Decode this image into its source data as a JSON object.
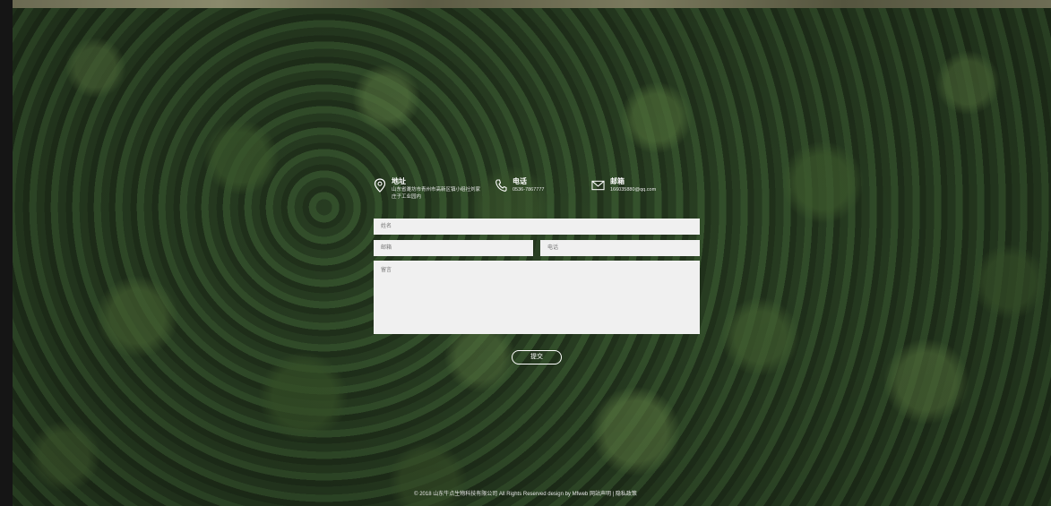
{
  "contact": {
    "address": {
      "title": "地址",
      "text": "山东省潍坊市青州市高新区镇小组社刘家庄子工业园内"
    },
    "phone": {
      "title": "电话",
      "text": "0536-7867777"
    },
    "email": {
      "title": "邮箱",
      "text": "166035880@qq.com"
    }
  },
  "form": {
    "name_placeholder": "姓名",
    "email_placeholder": "邮箱",
    "phone_placeholder": "电话",
    "message_placeholder": "留言",
    "submit_label": "提交"
  },
  "footer": {
    "copyright": "© 2018 山东牛点生物科技有限公司 All Rights Reserved design by Mfweb",
    "link_legal": "网站声明",
    "link_privacy": "隐私政策"
  },
  "colors": {
    "field_bg": "#f0f0f0",
    "text": "#ffffff"
  }
}
